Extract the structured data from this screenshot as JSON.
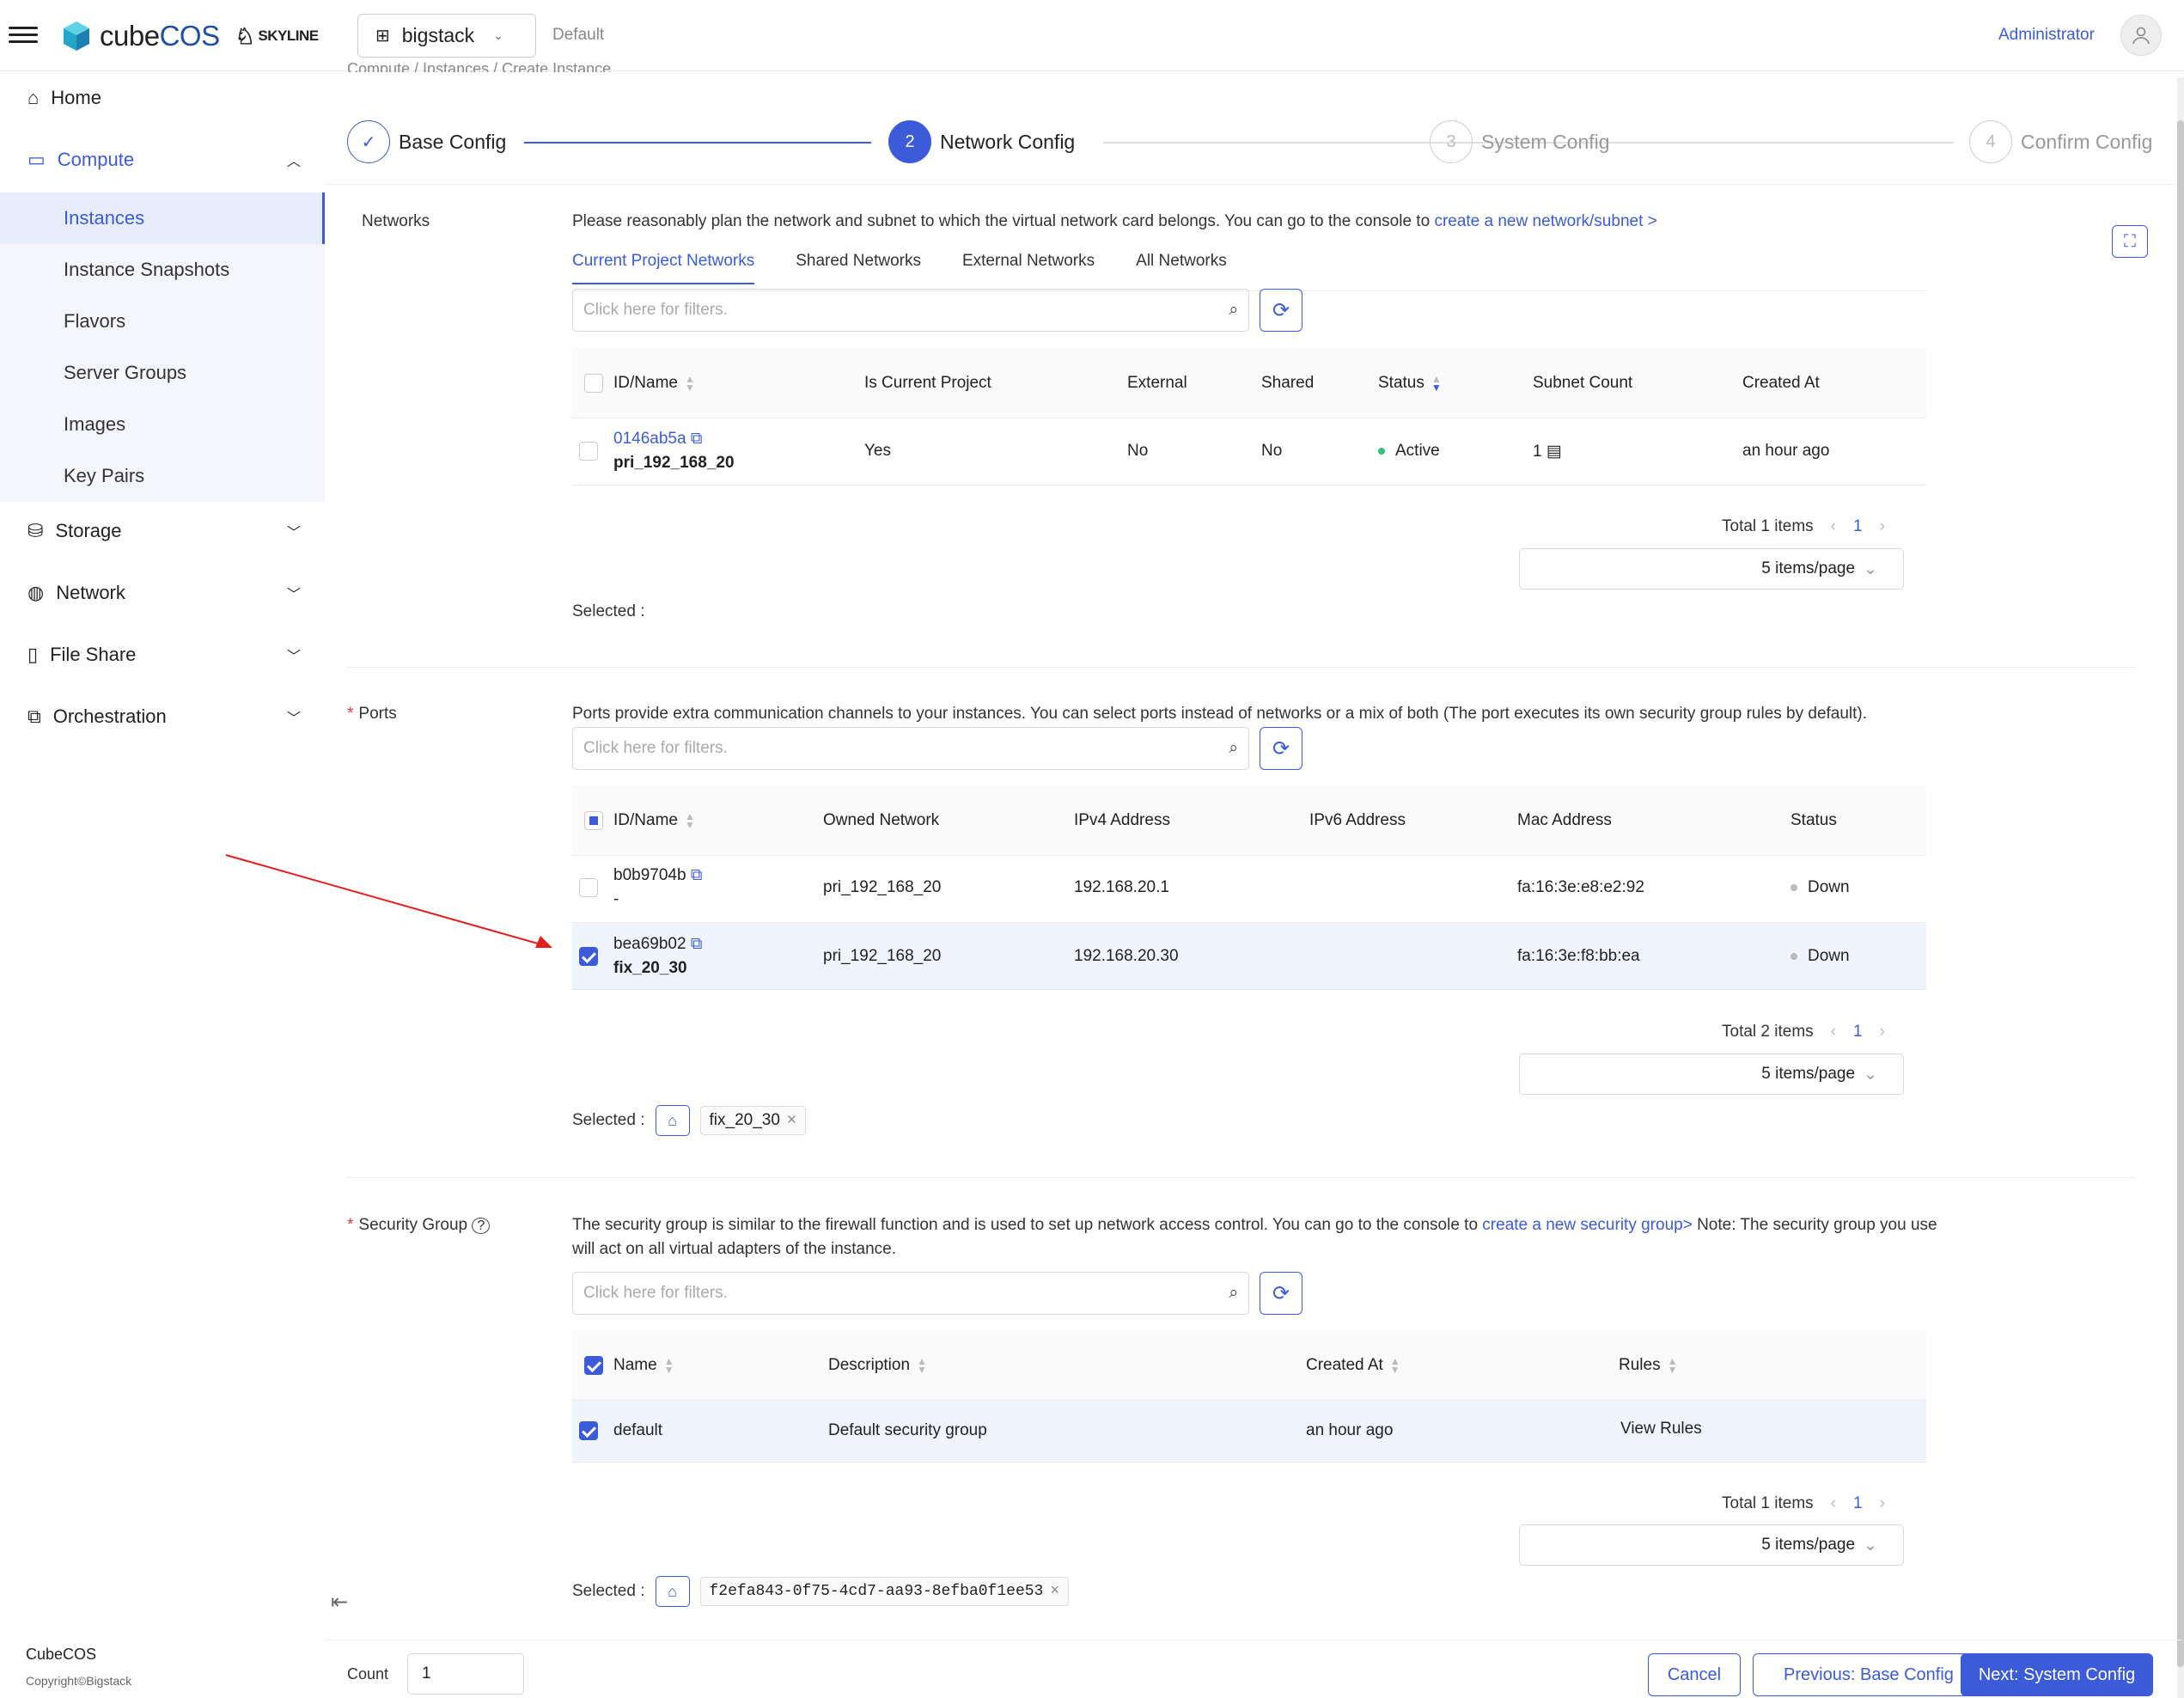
{
  "topbar": {
    "logo_cube": "cube",
    "logo_os": "COS",
    "logo_partner": "SKYLINE",
    "project": "bigstack",
    "domain": "Default",
    "user": "Administrator"
  },
  "sidebar": {
    "home": "Home",
    "compute": "Compute",
    "compute_items": [
      "Instances",
      "Instance Snapshots",
      "Flavors",
      "Server Groups",
      "Images",
      "Key Pairs"
    ],
    "storage": "Storage",
    "network": "Network",
    "file_share": "File Share",
    "orchestration": "Orchestration",
    "footer_title": "CubeCOS",
    "footer_copy": "Copyright©Bigstack"
  },
  "breadcrumb": "Compute  /  Instances  /  Create Instance",
  "steps": [
    {
      "num": "✓",
      "label": "Base Config",
      "state": "done"
    },
    {
      "num": "2",
      "label": "Network Config",
      "state": "active"
    },
    {
      "num": "3",
      "label": "System Config",
      "state": "pending"
    },
    {
      "num": "4",
      "label": "Confirm Config",
      "state": "pending"
    }
  ],
  "networks": {
    "label": "Networks",
    "desc": "Please reasonably plan the network and subnet to which the virtual network card belongs. You can go to the console to ",
    "desc_link": "create a new network/subnet >",
    "tabs": [
      "Current Project Networks",
      "Shared Networks",
      "External Networks",
      "All Networks"
    ],
    "filter_placeholder": "Click here for filters.",
    "columns": [
      "ID/Name",
      "Is Current Project",
      "External",
      "Shared",
      "Status",
      "Subnet Count",
      "Created At"
    ],
    "rows": [
      {
        "id": "0146ab5a",
        "name": "pri_192_168_20",
        "current": "Yes",
        "external": "No",
        "shared": "No",
        "status": "Active",
        "subnets": "1",
        "created": "an hour ago"
      }
    ],
    "total": "Total 1 items",
    "page": "1",
    "page_size": "5 items/page",
    "selected_label": "Selected :"
  },
  "ports": {
    "label": "Ports",
    "desc": "Ports provide extra communication channels to your instances. You can select ports instead of networks or a mix of both (The port executes its own security group rules by default).",
    "filter_placeholder": "Click here for filters.",
    "columns": [
      "ID/Name",
      "Owned Network",
      "IPv4 Address",
      "IPv6 Address",
      "Mac Address",
      "Status"
    ],
    "rows": [
      {
        "id": "b0b9704b",
        "name": "-",
        "network": "pri_192_168_20",
        "ipv4": "192.168.20.1",
        "ipv6": "",
        "mac": "fa:16:3e:e8:e2:92",
        "status": "Down"
      },
      {
        "id": "bea69b02",
        "name": "fix_20_30",
        "network": "pri_192_168_20",
        "ipv4": "192.168.20.30",
        "ipv6": "",
        "mac": "fa:16:3e:f8:bb:ea",
        "status": "Down"
      }
    ],
    "total": "Total 2 items",
    "page": "1",
    "page_size": "5 items/page",
    "selected_label": "Selected :",
    "selected_tag": "fix_20_30"
  },
  "security": {
    "label": "Security Group",
    "desc": "The security group is similar to the firewall function and is used to set up network access control. You can go to the console to ",
    "desc_link": "create a new security group>",
    "desc_tail": " Note: The security group you use will act on all virtual adapters of the instance.",
    "filter_placeholder": "Click here for filters.",
    "columns": [
      "Name",
      "Description",
      "Created At",
      "Rules"
    ],
    "rows": [
      {
        "name": "default",
        "description": "Default security group",
        "created": "an hour ago",
        "rules": "View Rules"
      }
    ],
    "total": "Total 1 items",
    "page": "1",
    "page_size": "5 items/page",
    "selected_label": "Selected :",
    "selected_tag": "f2efa843-0f75-4cd7-aa93-8efba0f1ee53"
  },
  "footer": {
    "count_label": "Count",
    "count_value": "1",
    "cancel": "Cancel",
    "prev": "Previous: Base Config",
    "next": "Next: System Config"
  },
  "colors": {
    "accent": "#3b5bd9",
    "active_green": "#2fc47a",
    "down_gray": "#bbbbbb",
    "arrow_red": "#e02020"
  }
}
